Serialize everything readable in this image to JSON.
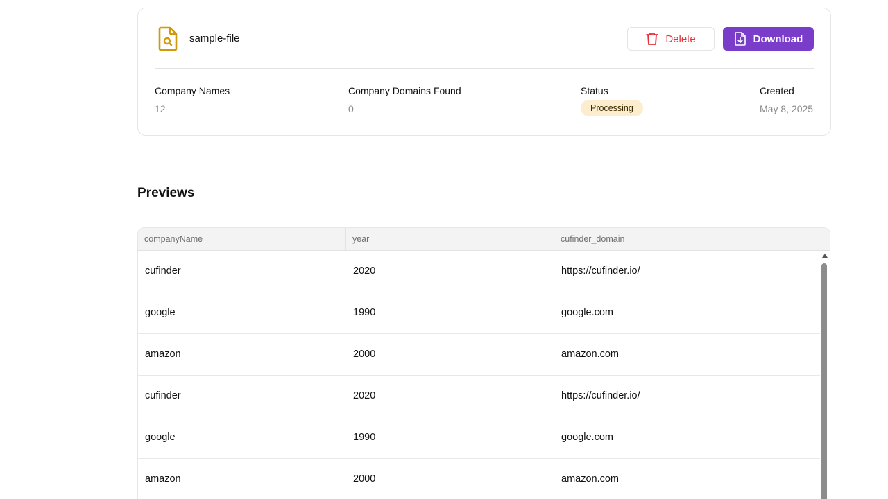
{
  "file": {
    "name": "sample-file",
    "icon": "file-search-icon",
    "delete_label": "Delete",
    "download_label": "Download"
  },
  "stats": {
    "company_names": {
      "label": "Company Names",
      "value": "12"
    },
    "domains_found": {
      "label": "Company Domains Found",
      "value": "0"
    },
    "status": {
      "label": "Status",
      "value": "Processing"
    },
    "created": {
      "label": "Created",
      "value": "May 8, 2025"
    }
  },
  "previews": {
    "title": "Previews",
    "columns": [
      "companyName",
      "year",
      "cufinder_domain",
      ""
    ],
    "rows": [
      [
        "cufinder",
        "2020",
        "https://cufinder.io/"
      ],
      [
        "google",
        "1990",
        "google.com"
      ],
      [
        "amazon",
        "2000",
        "amazon.com"
      ],
      [
        "cufinder",
        "2020",
        "https://cufinder.io/"
      ],
      [
        "google",
        "1990",
        "google.com"
      ],
      [
        "amazon",
        "2000",
        "amazon.com"
      ]
    ]
  },
  "colors": {
    "accent": "#7a3dc9",
    "danger": "#e5303a",
    "file_icon": "#d19a0b",
    "badge_bg": "#fdedcf"
  }
}
